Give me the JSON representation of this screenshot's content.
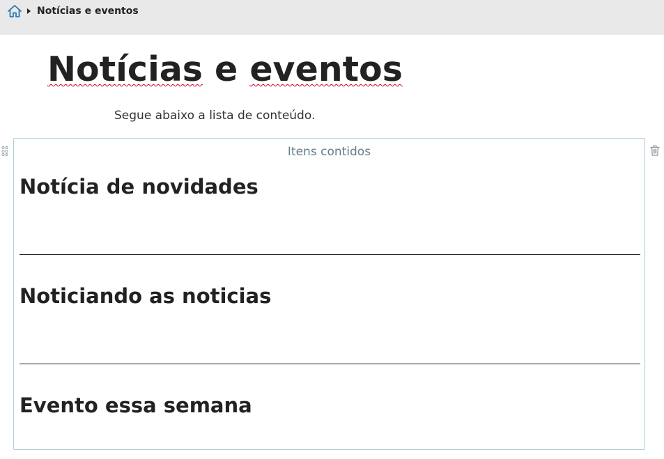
{
  "breadcrumb": {
    "home_icon": "home-icon",
    "current": "Notícias e eventos"
  },
  "page": {
    "title_word_1": "Notícias",
    "title_word_2": "e",
    "title_word_3": "eventos",
    "description": "Segue abaixo a lista de conteúdo."
  },
  "block": {
    "header": "Itens contidos",
    "drag_icon": "drag-handle-icon",
    "delete_icon": "trash-icon",
    "items": [
      {
        "title": "Notícia de novidades"
      },
      {
        "title": "Noticiando as noticias"
      },
      {
        "title": "Evento essa semana"
      }
    ]
  },
  "colors": {
    "breadcrumb_bg": "#e9e9e9",
    "home_icon": "#2a7ab0",
    "block_border": "#a9cfde",
    "block_header_text": "#5f7f88",
    "spellcheck_underline": "#d0021b"
  }
}
